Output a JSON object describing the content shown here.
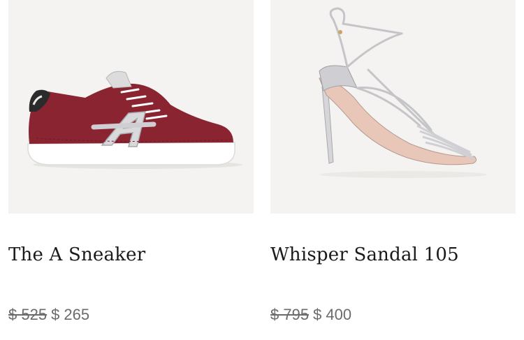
{
  "products": [
    {
      "name": "The A Sneaker",
      "price_original": "$ 525",
      "price_sale": "$ 265",
      "image_alt": "burgundy suede sneaker"
    },
    {
      "name": "Whisper Sandal 105",
      "price_original": "$ 795",
      "price_sale": "$ 400",
      "image_alt": "silver strappy high heel sandal"
    }
  ],
  "colors": {
    "image_background": "#f4f3f1",
    "title": "#1a1a1a",
    "price": "#6b6b6b",
    "sneaker_suede": "#8a2430",
    "sandal_silver": "#c9c9cc"
  }
}
